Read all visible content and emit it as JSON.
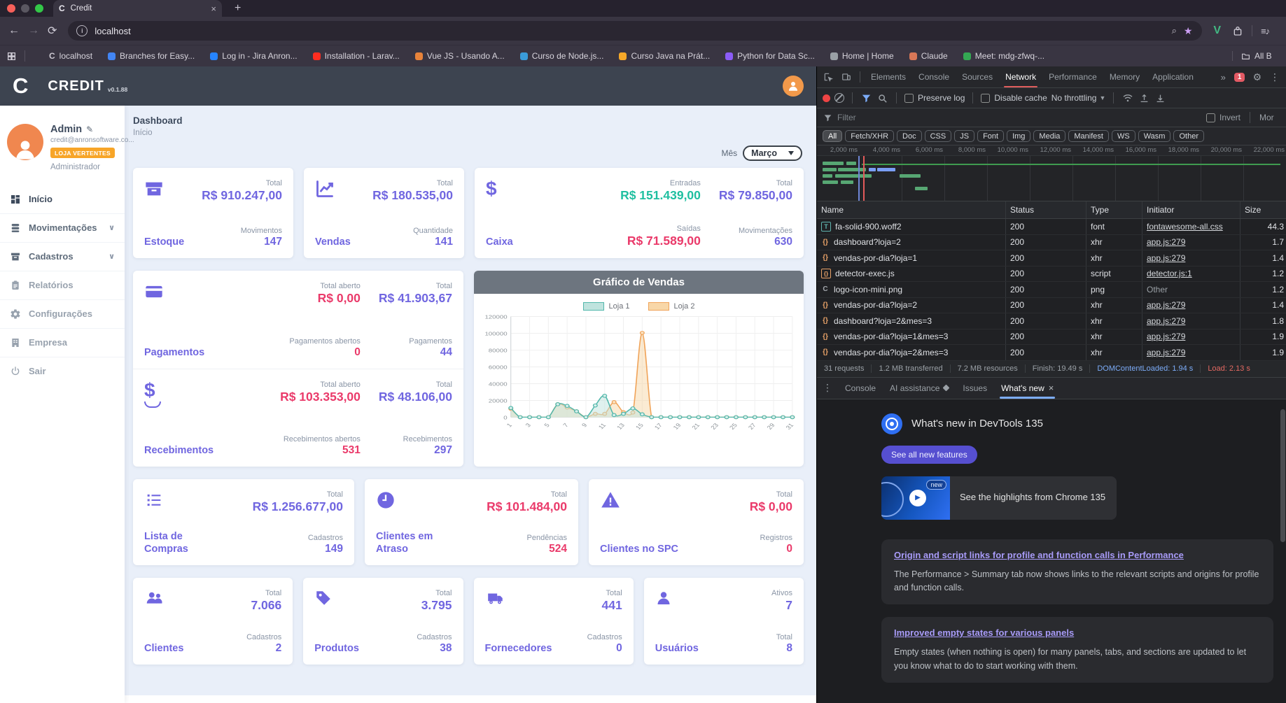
{
  "browser": {
    "tab_title": "Credit",
    "url": "localhost",
    "bookmarks": [
      {
        "label": "localhost",
        "glyph": "C",
        "color": "#b9b6c0"
      },
      {
        "label": "Branches for Easy...",
        "color": "#4285f4"
      },
      {
        "label": "Log in - Jira Anron...",
        "color": "#2684ff"
      },
      {
        "label": "Installation - Larav...",
        "color": "#ff2d20"
      },
      {
        "label": "Vue JS - Usando A...",
        "color": "#e8833a"
      },
      {
        "label": "Curso de Node.js...",
        "color": "#3a9bd8"
      },
      {
        "label": "Curso Java na Prát...",
        "color": "#f6a829"
      },
      {
        "label": "Python for Data Sc...",
        "color": "#8b5cf6"
      },
      {
        "label": "Home | Home",
        "color": "#9aa0a6"
      },
      {
        "label": "Claude",
        "color": "#d97757"
      },
      {
        "label": "Meet: mdg-zfwq-...",
        "color": "#34a853"
      }
    ],
    "all_bookmarks_label": "All B"
  },
  "app": {
    "brand": "CREDIT",
    "version": "v0.1.88",
    "user": {
      "name": "Admin",
      "email": "credit@anronsoftware.co...",
      "store_badge": "LOJA VERTENTES",
      "role": "Administrador"
    },
    "menu": [
      {
        "label": "Início"
      },
      {
        "label": "Movimentações"
      },
      {
        "label": "Cadastros"
      },
      {
        "label": "Relatórios"
      },
      {
        "label": "Configurações"
      },
      {
        "label": "Empresa"
      },
      {
        "label": "Sair"
      }
    ],
    "page": {
      "title": "Dashboard",
      "subtitle": "Início"
    },
    "month_filter": {
      "label": "Mês",
      "value": "Março"
    },
    "cards": {
      "estoque": {
        "title": "Estoque",
        "stats": [
          {
            "label": "Total",
            "value": "R$ 910.247,00"
          },
          {
            "label": "Movimentos",
            "value": "147"
          }
        ]
      },
      "vendas": {
        "title": "Vendas",
        "stats": [
          {
            "label": "Total",
            "value": "R$ 180.535,00"
          },
          {
            "label": "Quantidade",
            "value": "141"
          }
        ]
      },
      "caixa": {
        "title": "Caixa",
        "col1": [
          {
            "label": "Entradas",
            "value": "R$ 151.439,00"
          },
          {
            "label": "Saídas",
            "value": "R$ 71.589,00"
          }
        ],
        "col2": [
          {
            "label": "Total",
            "value": "R$ 79.850,00"
          },
          {
            "label": "Movimentações",
            "value": "630"
          }
        ]
      },
      "pagamentos": {
        "title": "Pagamentos",
        "col1": [
          {
            "label": "Total aberto",
            "value": "R$ 0,00"
          },
          {
            "label": "Pagamentos abertos",
            "value": "0"
          }
        ],
        "col2": [
          {
            "label": "Total",
            "value": "R$ 41.903,67"
          },
          {
            "label": "Pagamentos",
            "value": "44"
          }
        ]
      },
      "recebimentos": {
        "title": "Recebimentos",
        "col1": [
          {
            "label": "Total aberto",
            "value": "R$ 103.353,00"
          },
          {
            "label": "Recebimentos abertos",
            "value": "531"
          }
        ],
        "col2": [
          {
            "label": "Total",
            "value": "R$ 48.106,00"
          },
          {
            "label": "Recebimentos",
            "value": "297"
          }
        ]
      },
      "lista_compras": {
        "title": "Lista de Compras",
        "stats": [
          {
            "label": "Total",
            "value": "R$ 1.256.677,00"
          },
          {
            "label": "Cadastros",
            "value": "149"
          }
        ]
      },
      "clientes_atraso": {
        "title": "Clientes em Atraso",
        "stats": [
          {
            "label": "Total",
            "value": "R$ 101.484,00"
          },
          {
            "label": "Pendências",
            "value": "524"
          }
        ]
      },
      "clientes_spc": {
        "title": "Clientes no SPC",
        "stats": [
          {
            "label": "Total",
            "value": "R$ 0,00"
          },
          {
            "label": "Registros",
            "value": "0"
          }
        ]
      },
      "clientes": {
        "title": "Clientes",
        "stats": [
          {
            "label": "Total",
            "value": "7.066"
          },
          {
            "label": "Cadastros",
            "value": "2"
          }
        ]
      },
      "produtos": {
        "title": "Produtos",
        "stats": [
          {
            "label": "Total",
            "value": "3.795"
          },
          {
            "label": "Cadastros",
            "value": "38"
          }
        ]
      },
      "fornecedores": {
        "title": "Fornecedores",
        "stats": [
          {
            "label": "Total",
            "value": "441"
          },
          {
            "label": "Cadastros",
            "value": "0"
          }
        ]
      },
      "usuarios": {
        "title": "Usuários",
        "stats": [
          {
            "label": "Ativos",
            "value": "7"
          },
          {
            "label": "Total",
            "value": "8"
          }
        ]
      }
    }
  },
  "devtools": {
    "tabs": [
      "Elements",
      "Console",
      "Sources",
      "Network",
      "Performance",
      "Memory",
      "Application"
    ],
    "selected_tab": "Network",
    "overflow_icon": "»",
    "error_badge": "1",
    "network": {
      "preserve_log_label": "Preserve log",
      "disable_cache_label": "Disable cache",
      "throttling": "No throttling",
      "filter_placeholder": "Filter",
      "invert_label": "Invert",
      "more_filters_label": "Mor",
      "filters": [
        "All",
        "Fetch/XHR",
        "Doc",
        "CSS",
        "JS",
        "Font",
        "Img",
        "Media",
        "Manifest",
        "WS",
        "Wasm",
        "Other"
      ],
      "selected_filter": "All",
      "ruler_labels": [
        "2,000 ms",
        "4,000 ms",
        "6,000 ms",
        "8,000 ms",
        "10,000 ms",
        "12,000 ms",
        "14,000 ms",
        "16,000 ms",
        "18,000 ms",
        "20,000 ms",
        "22,000 ms"
      ],
      "columns": [
        "Name",
        "Status",
        "Type",
        "Initiator",
        "Size"
      ],
      "requests": [
        {
          "kind": "font",
          "name": "fa-solid-900.woff2",
          "status": "200",
          "type": "font",
          "initiator": "fontawesome-all.css",
          "initiator_is_link": true,
          "size": "44.3"
        },
        {
          "kind": "xhr",
          "name": "dashboard?loja=2",
          "status": "200",
          "type": "xhr",
          "initiator": "app.js:279",
          "initiator_is_link": true,
          "size": "1.7"
        },
        {
          "kind": "xhr",
          "name": "vendas-por-dia?loja=1",
          "status": "200",
          "type": "xhr",
          "initiator": "app.js:279",
          "initiator_is_link": true,
          "size": "1.4"
        },
        {
          "kind": "script",
          "name": "detector-exec.js",
          "status": "200",
          "type": "script",
          "initiator": "detector.js:1",
          "initiator_is_link": true,
          "size": "1.2"
        },
        {
          "kind": "img",
          "name": "logo-icon-mini.png",
          "status": "200",
          "type": "png",
          "initiator": "Other",
          "initiator_is_link": false,
          "size": "1.2"
        },
        {
          "kind": "xhr",
          "name": "vendas-por-dia?loja=2",
          "status": "200",
          "type": "xhr",
          "initiator": "app.js:279",
          "initiator_is_link": true,
          "size": "1.4"
        },
        {
          "kind": "xhr",
          "name": "dashboard?loja=2&mes=3",
          "status": "200",
          "type": "xhr",
          "initiator": "app.js:279",
          "initiator_is_link": true,
          "size": "1.8"
        },
        {
          "kind": "xhr",
          "name": "vendas-por-dia?loja=1&mes=3",
          "status": "200",
          "type": "xhr",
          "initiator": "app.js:279",
          "initiator_is_link": true,
          "size": "1.9"
        },
        {
          "kind": "xhr",
          "name": "vendas-por-dia?loja=2&mes=3",
          "status": "200",
          "type": "xhr",
          "initiator": "app.js:279",
          "initiator_is_link": true,
          "size": "1.9"
        }
      ],
      "summary": [
        {
          "text": "31 requests"
        },
        {
          "text": "1.2 MB transferred"
        },
        {
          "text": "7.2 MB resources"
        },
        {
          "text": "Finish: 19.49 s"
        },
        {
          "text": "DOMContentLoaded: 1.94 s",
          "color": "#7cacf8"
        },
        {
          "text": "Load: 2.13 s",
          "color": "#e46962"
        }
      ]
    },
    "drawer": {
      "tabs": [
        "Console",
        "AI assistance",
        "Issues",
        "What's new"
      ],
      "active_tab": "What's new"
    },
    "whats_new": {
      "title": "What's new in DevTools 135",
      "button_label": "See all new features",
      "badge": "new",
      "highlight": "See the highlights from Chrome 135",
      "features": [
        {
          "title": "Origin and script links for profile and function calls in Performance",
          "text": "The Performance > Summary tab now shows links to the relevant scripts and origins for profile and function calls."
        },
        {
          "title": "Improved empty states for various panels",
          "text": "Empty states (when nothing is open) for many panels, tabs, and sections are updated to let you know what to do to start working with them."
        }
      ]
    }
  },
  "chart_data": {
    "type": "line",
    "title": "Gráfico de Vendas",
    "x_count": 31,
    "x_ticks": [
      "1",
      "3",
      "5",
      "7",
      "9",
      "11",
      "13",
      "15",
      "17",
      "19",
      "21",
      "23",
      "25",
      "27",
      "29",
      "31"
    ],
    "ylim": [
      0,
      120000
    ],
    "yticks": [
      0,
      20000,
      40000,
      60000,
      80000,
      100000,
      120000
    ],
    "grid": true,
    "legend_position": "top",
    "series": [
      {
        "name": "Loja 1",
        "color": "#52b7ab",
        "fill": "#bfe3de",
        "marker_fill": "#d9efeb",
        "values": [
          11000,
          0,
          0,
          0,
          0,
          15500,
          13500,
          7000,
          0,
          14000,
          25500,
          2500,
          4000,
          10500,
          3500,
          0,
          0,
          0,
          0,
          0,
          0,
          0,
          0,
          0,
          0,
          0,
          0,
          0,
          0,
          0,
          0
        ]
      },
      {
        "name": "Loja 2",
        "color": "#f0a45a",
        "fill": "#f8d7a8",
        "marker_fill": "#fbe3c2",
        "values": [
          10000,
          0,
          0,
          0,
          0,
          15500,
          11500,
          7000,
          0,
          4000,
          4000,
          18000,
          6000,
          5500,
          100500,
          0,
          0,
          0,
          0,
          0,
          0,
          0,
          0,
          0,
          0,
          0,
          0,
          0,
          0,
          0,
          0
        ]
      }
    ]
  }
}
